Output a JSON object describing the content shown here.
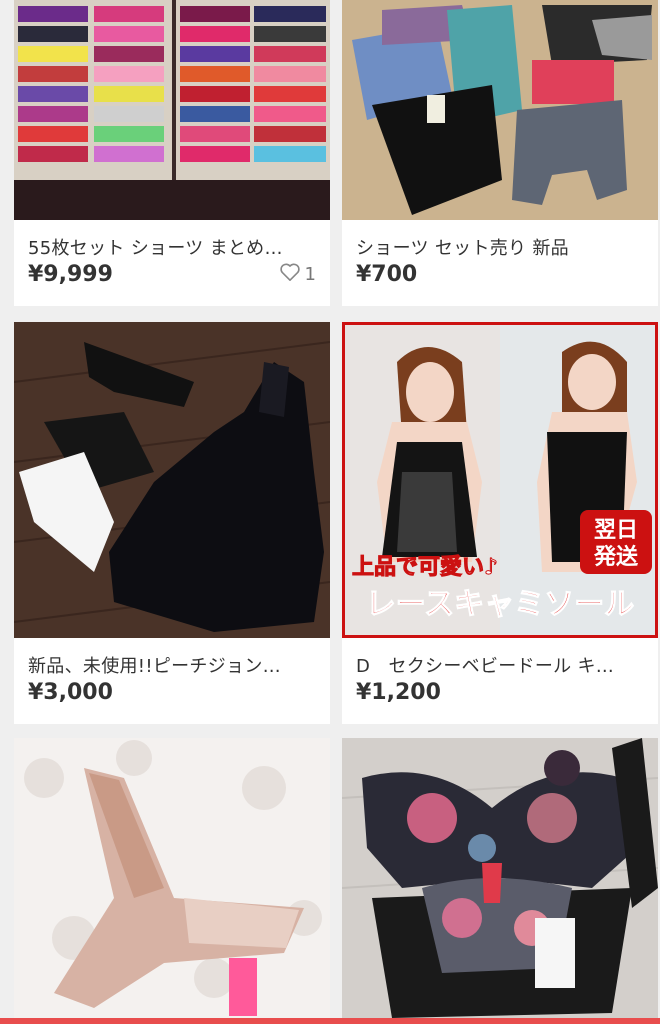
{
  "items": [
    {
      "title": "55枚セット ショーツ まとめ…",
      "price": "¥9,999",
      "likes": "1",
      "image": "drawer of colorful folded underwear"
    },
    {
      "title": "ショーツ セット売り 新品",
      "price": "¥700",
      "image": "assorted shorts and panties with tags"
    },
    {
      "title": "新品、未使用!!ピーチジョン…",
      "price": "¥3,000",
      "image": "black lace lingerie set and white lace on wooden floor"
    },
    {
      "title": "D　セクシーベビードール キ…",
      "price": "¥1,200",
      "image": "model wearing black lace camisole",
      "overlay": {
        "badge": "翌日\n発送",
        "badge_line1": "翌日",
        "badge_line2": "発送",
        "tagline": "上品で可愛い♪",
        "headline": "レースキャミソール"
      }
    },
    {
      "title": "",
      "price": "",
      "image": "pink embroidered thong on white fur"
    },
    {
      "title": "",
      "price": "",
      "image": "floral bra and panty set with tags"
    }
  ],
  "icons": {
    "like": "heart-outline-icon"
  },
  "colors": {
    "accent": "#e84d4d",
    "badge_red": "#cc1111",
    "headline_red": "#e02020"
  }
}
